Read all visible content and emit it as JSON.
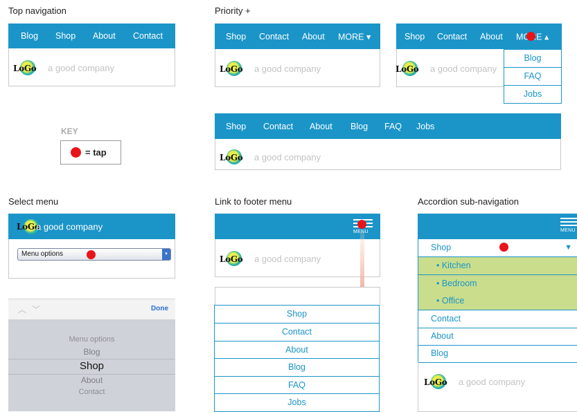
{
  "titles": {
    "top_nav": "Top navigation",
    "priority": "Priority +",
    "select_menu": "Select menu",
    "footer_menu": "Link to footer menu",
    "accordion": "Accordion sub-navigation"
  },
  "logo": {
    "text": "LoGo",
    "tagline": "a good company"
  },
  "top_nav": {
    "items": [
      "Blog",
      "Shop",
      "About",
      "Contact"
    ]
  },
  "priority": {
    "collapsed_items": [
      "Shop",
      "Contact",
      "About",
      "MORE ▾"
    ],
    "open_items": [
      "Shop",
      "Contact",
      "About",
      "MORE ▴"
    ],
    "dropdown_items": [
      "Blog",
      "FAQ",
      "Jobs"
    ],
    "wide_items": [
      "Shop",
      "Contact",
      "About",
      "Blog",
      "FAQ",
      "Jobs"
    ]
  },
  "key": {
    "heading": "KEY",
    "label": "= tap"
  },
  "select_menu": {
    "value": "Menu options",
    "done_label": "Done",
    "picker_items": [
      "Menu options",
      "Blog",
      "Shop",
      "About",
      "Contact"
    ]
  },
  "footer_menu": {
    "menu_label": "MENU",
    "items": [
      "Shop",
      "Contact",
      "About",
      "Blog",
      "FAQ",
      "Jobs"
    ]
  },
  "accordion": {
    "menu_label": "MENU",
    "shop_label": "Shop",
    "sub_items": [
      "• Kitchen",
      "• Bedroom",
      "• Office"
    ],
    "items": [
      "Contact",
      "About",
      "Blog"
    ],
    "arrow": "▼"
  },
  "colors": {
    "nav_blue": "#1b95c8",
    "tap_red": "#e8141a",
    "sub_green": "#c9dd8c",
    "picker_gray": "#cfd2d8"
  }
}
